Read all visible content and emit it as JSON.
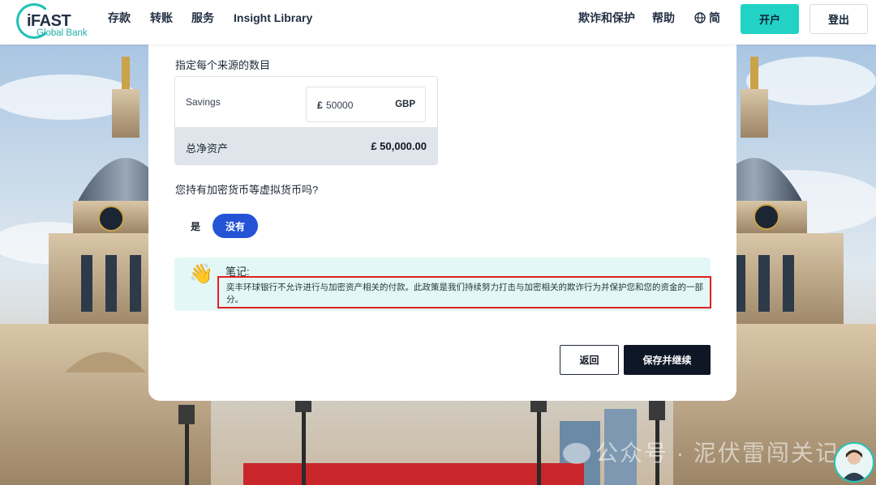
{
  "header": {
    "brand": "iFAST",
    "brand_sub": "Global Bank",
    "nav": [
      "存款",
      "转账",
      "服务",
      "Insight Library"
    ],
    "right_links": [
      "欺诈和保护",
      "帮助"
    ],
    "language": "简",
    "open_account_label": "开户",
    "logout_label": "登出"
  },
  "form": {
    "sources_question": "指定每个来源的数目",
    "sources": [
      {
        "label": "Savings",
        "currency_symbol": "£",
        "amount": "50000",
        "currency_code": "GBP"
      }
    ],
    "total_label": "总净资产",
    "total_value": "£ 50,000.00",
    "crypto_question": "您持有加密货币等虚拟货币吗?",
    "options": {
      "yes": "是",
      "no": "没有",
      "selected": "没有"
    },
    "note": {
      "icon": "waving-hand-icon",
      "title": "笔记:",
      "text": "奕丰环球银行不允许进行与加密资产相关的付款。此政策是我们持续努力打击与加密相关的欺诈行为并保护您和您的资金的一部分。"
    },
    "back_label": "返回",
    "save_label": "保存并继续"
  },
  "watermark": {
    "text": "公众号 · 泥伏雷闯关记"
  },
  "colors": {
    "accent_teal": "#22d3c5",
    "primary_blue": "#2453d6",
    "dark": "#0e1726",
    "highlight_red": "#e0201e"
  }
}
